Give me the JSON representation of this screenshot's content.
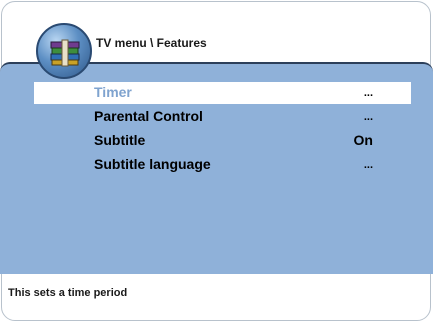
{
  "header": {
    "breadcrumb": "TV menu \\ Features",
    "app_icon": "tv-features-icon"
  },
  "menu": {
    "items": [
      {
        "label": "Timer",
        "value": "...",
        "selected": true
      },
      {
        "label": "Parental Control",
        "value": "...",
        "selected": false
      },
      {
        "label": "Subtitle",
        "value": "On",
        "selected": false
      },
      {
        "label": "Subtitle language",
        "value": "...",
        "selected": false
      }
    ]
  },
  "status": {
    "text": "This sets a time period"
  },
  "colors": {
    "panel": "#8fb1d9",
    "selected_text": "#7fa3cf",
    "border": "#2c3f5a"
  }
}
